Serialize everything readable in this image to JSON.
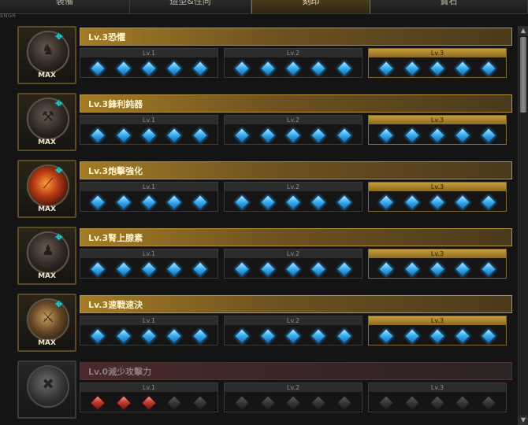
{
  "tabs": [
    {
      "label": "裝備",
      "active": false
    },
    {
      "label": "造型&性向",
      "active": false
    },
    {
      "label": "刻印",
      "active": true
    },
    {
      "label": "寶石",
      "active": false
    }
  ],
  "subheader": "ENGR",
  "engravings": [
    {
      "title": "Lv.3恐懼",
      "max_label": "MAX",
      "level": 3,
      "icon": "dark-figure-icon",
      "levels": [
        "Lv.1",
        "Lv.2",
        "Lv.3"
      ],
      "gem_color": "blue",
      "filled": 15
    },
    {
      "title": "Lv.3鋒利鈍器",
      "max_label": "MAX",
      "level": 3,
      "icon": "hammer-icon",
      "levels": [
        "Lv.1",
        "Lv.2",
        "Lv.3"
      ],
      "gem_color": "blue",
      "filled": 15
    },
    {
      "title": "Lv.3炮擊強化",
      "max_label": "MAX",
      "level": 3,
      "icon": "flame-slash-icon",
      "levels": [
        "Lv.1",
        "Lv.2",
        "Lv.3"
      ],
      "gem_color": "blue",
      "filled": 15
    },
    {
      "title": "Lv.3腎上腺素",
      "max_label": "MAX",
      "level": 3,
      "icon": "fighter-icon",
      "levels": [
        "Lv.1",
        "Lv.2",
        "Lv.3"
      ],
      "gem_color": "blue",
      "filled": 15
    },
    {
      "title": "Lv.3速戰速決",
      "max_label": "MAX",
      "level": 3,
      "icon": "runner-icon",
      "levels": [
        "Lv.1",
        "Lv.2",
        "Lv.3"
      ],
      "gem_color": "blue",
      "filled": 15
    },
    {
      "title": "Lv.0減少攻擊力",
      "max_label": "",
      "level": 0,
      "icon": "broken-shield-icon",
      "levels": [
        "Lv.1",
        "Lv.2",
        "Lv.3"
      ],
      "gem_color": "red",
      "filled": 3
    }
  ],
  "scrollbar": {
    "up": "▲",
    "down": "▼"
  }
}
